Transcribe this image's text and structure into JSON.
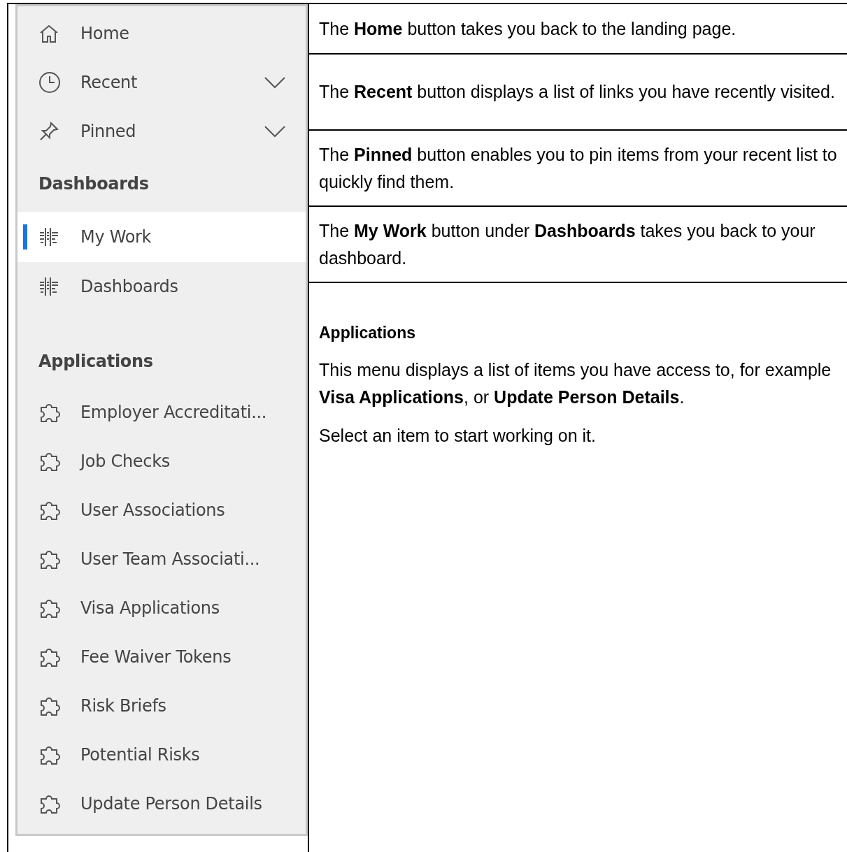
{
  "sidebar": {
    "nav": [
      {
        "label": "Home",
        "kind": "home",
        "expandable": false
      },
      {
        "label": "Recent",
        "kind": "recent",
        "expandable": true
      },
      {
        "label": "Pinned",
        "kind": "pinned",
        "expandable": true
      }
    ],
    "sections": [
      {
        "title": "Dashboards",
        "kind": "dashboards",
        "items": [
          {
            "label": "My Work",
            "selected": true
          },
          {
            "label": "Dashboards",
            "selected": false
          }
        ]
      },
      {
        "title": "Applications",
        "kind": "applications",
        "items": [
          {
            "label": "Employer Accreditati...",
            "selected": false
          },
          {
            "label": "Job Checks",
            "selected": false
          },
          {
            "label": "User Associations",
            "selected": false
          },
          {
            "label": "User Team Associati...",
            "selected": false
          },
          {
            "label": "Visa Applications",
            "selected": false
          },
          {
            "label": "Fee Waiver Tokens",
            "selected": false
          },
          {
            "label": "Risk Briefs",
            "selected": false
          },
          {
            "label": "Potential Risks",
            "selected": false
          },
          {
            "label": "Update Person Details",
            "selected": false
          }
        ]
      }
    ]
  },
  "descriptions": [
    "The **Home** button takes you back to the landing page.",
    "The **Recent** button displays a list of links you have recently visited.",
    "The **Pinned** button enables you to pin items from your recent list to quickly find them.",
    "The **My Work** button under **Dashboards** takes you back to your dashboard."
  ],
  "applications_help": {
    "title": "Applications",
    "paragraphs": [
      "This menu displays a list of items you have access to, for example **Visa Applications**, or **Update Person Details**.",
      "Select an item to start working on it."
    ]
  }
}
